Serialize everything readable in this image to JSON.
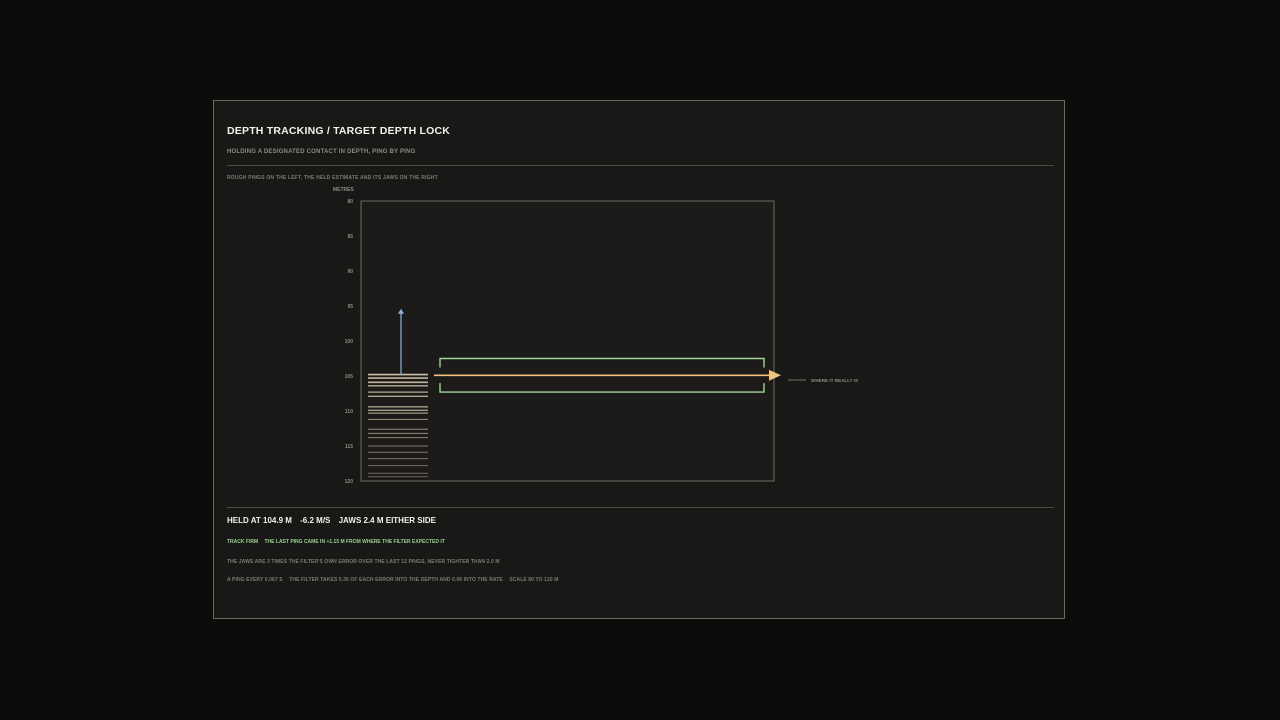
{
  "header": {
    "title": "DEPTH TRACKING / TARGET DEPTH LOCK",
    "subtitle": "HOLDING A DESIGNATED CONTACT IN DEPTH, PING BY PING"
  },
  "chart_caption": "ROUGH PINGS ON THE LEFT, THE HELD ESTIMATE AND ITS JAWS ON THE RIGHT",
  "chart_data": {
    "type": "strip",
    "ylabel": "METRES",
    "ylim": [
      80,
      120
    ],
    "yticks": [
      80,
      85,
      90,
      95,
      100,
      105,
      110,
      115,
      120
    ],
    "held_depth": 104.9,
    "rate": -6.2,
    "jaws_halfwidth": 2.4,
    "true_depth": 105.0,
    "true_label": "WHERE IT REALLY IS",
    "pings": [
      104.8,
      105.3,
      105.9,
      106.4,
      107.3,
      107.9,
      109.4,
      109.9,
      110.3,
      111.2,
      112.6,
      113.2,
      113.8,
      115.0,
      115.9,
      116.8,
      117.8,
      118.9,
      119.4
    ],
    "rate_arrow_top": 95.4,
    "colors": {
      "estimate": "#f1c27d",
      "jaws": "#9ed69a",
      "rate_arrow": "#8ab4dc",
      "ping": "#c9bea3",
      "axis": "#6b6b64",
      "grid": "#2b2b28"
    }
  },
  "readout": {
    "held": "HELD AT 104.9 M",
    "rate": "-6.2 M/S",
    "jaws": "JAWS  2.4 M EITHER SIDE"
  },
  "status": {
    "state": "TRACK FIRM",
    "message": "THE LAST PING CAME IN +1.15 M FROM WHERE THE FILTER EXPECTED IT"
  },
  "notes": {
    "jaws_rule": "THE JAWS ARE 3 TIMES THE FILTER'S OWN ERROR OVER THE LAST 12 PINGS, NEVER TIGHTER THAN 2.0 M",
    "ping_rate": "A PING EVERY 0.067 S",
    "filter_gain": "THE FILTER TAKES 0.35 OF EACH ERROR INTO THE DEPTH AND 0.06 INTO THE RATE",
    "scale": "SCALE 80 TO 120 M"
  }
}
